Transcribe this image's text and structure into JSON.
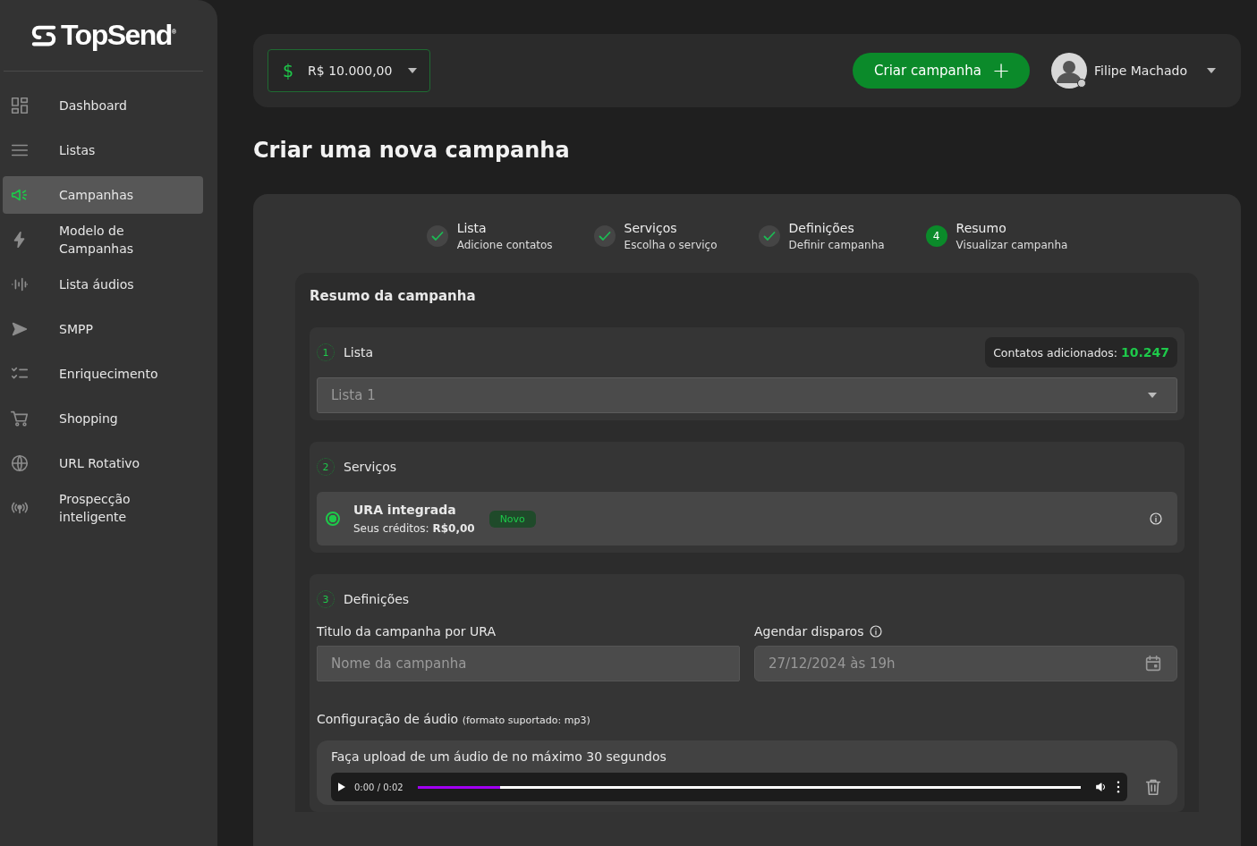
{
  "brand": {
    "logo_text": "TopSend",
    "mark": "®"
  },
  "sidebar": {
    "items": [
      {
        "label": "Dashboard",
        "kind": "grid",
        "selected": false
      },
      {
        "label": "Listas",
        "kind": "lines",
        "selected": false
      },
      {
        "label": "Campanhas",
        "kind": "megaphone",
        "selected": true
      },
      {
        "label": "Modelo de Campanhas",
        "kind": "bolt",
        "selected": false
      },
      {
        "label": "Lista áudios",
        "kind": "wave",
        "selected": false
      },
      {
        "label": "SMPP",
        "kind": "send",
        "selected": false
      },
      {
        "label": "Enriquecimento",
        "kind": "checklist",
        "selected": false
      },
      {
        "label": "Shopping",
        "kind": "cart",
        "selected": false
      },
      {
        "label": "URL Rotativo",
        "kind": "globe",
        "selected": false
      },
      {
        "label": "Prospecção inteligente",
        "kind": "broadcast",
        "selected": false
      }
    ]
  },
  "topbar": {
    "balance": {
      "currency_symbol": "$",
      "value": "R$ 10.000,00"
    },
    "create_button": {
      "label": "Criar campanha",
      "icon_text": "+"
    },
    "user": {
      "name": "Filipe Machado",
      "online": true
    }
  },
  "page_title": "Criar uma nova campanha",
  "steps": [
    {
      "label": "Lista",
      "caption": "Adicione contatos",
      "completed": true
    },
    {
      "label": "Serviços",
      "caption": "Escolha o serviço",
      "completed": true
    },
    {
      "label": "Definições",
      "caption": "Definir campanha",
      "completed": true
    },
    {
      "label": "Resumo",
      "caption": "Visualizar campanha",
      "completed": false,
      "number": "4"
    }
  ],
  "summary": {
    "title": "Resumo da campanha",
    "list_section": {
      "number": "1",
      "title": "Lista",
      "contacts_label": "Contatos adicionados:",
      "contacts_count": "10.247",
      "select_value": "Lista 1"
    },
    "services_section": {
      "number": "2",
      "title": "Serviços",
      "service": {
        "name": "URA integrada",
        "badge": "Novo",
        "credits_label": "Seus créditos:",
        "credits_value": "R$0,00",
        "selected": true
      }
    },
    "definitions_section": {
      "number": "3",
      "title": "Definições",
      "title_field": {
        "label": "Titulo da campanha por URA",
        "placeholder": "Nome da campanha"
      },
      "schedule_field": {
        "label": "Agendar disparos",
        "placeholder": "27/12/2024 às 19h"
      },
      "audio": {
        "label": "Configuração de áudio",
        "hint": "(formato suportado: mp3)",
        "upload_text": "Faça upload de um áudio de no máximo 30 segundos",
        "player": {
          "time": "0:00 / 0:02",
          "level": 0.125
        }
      }
    }
  }
}
